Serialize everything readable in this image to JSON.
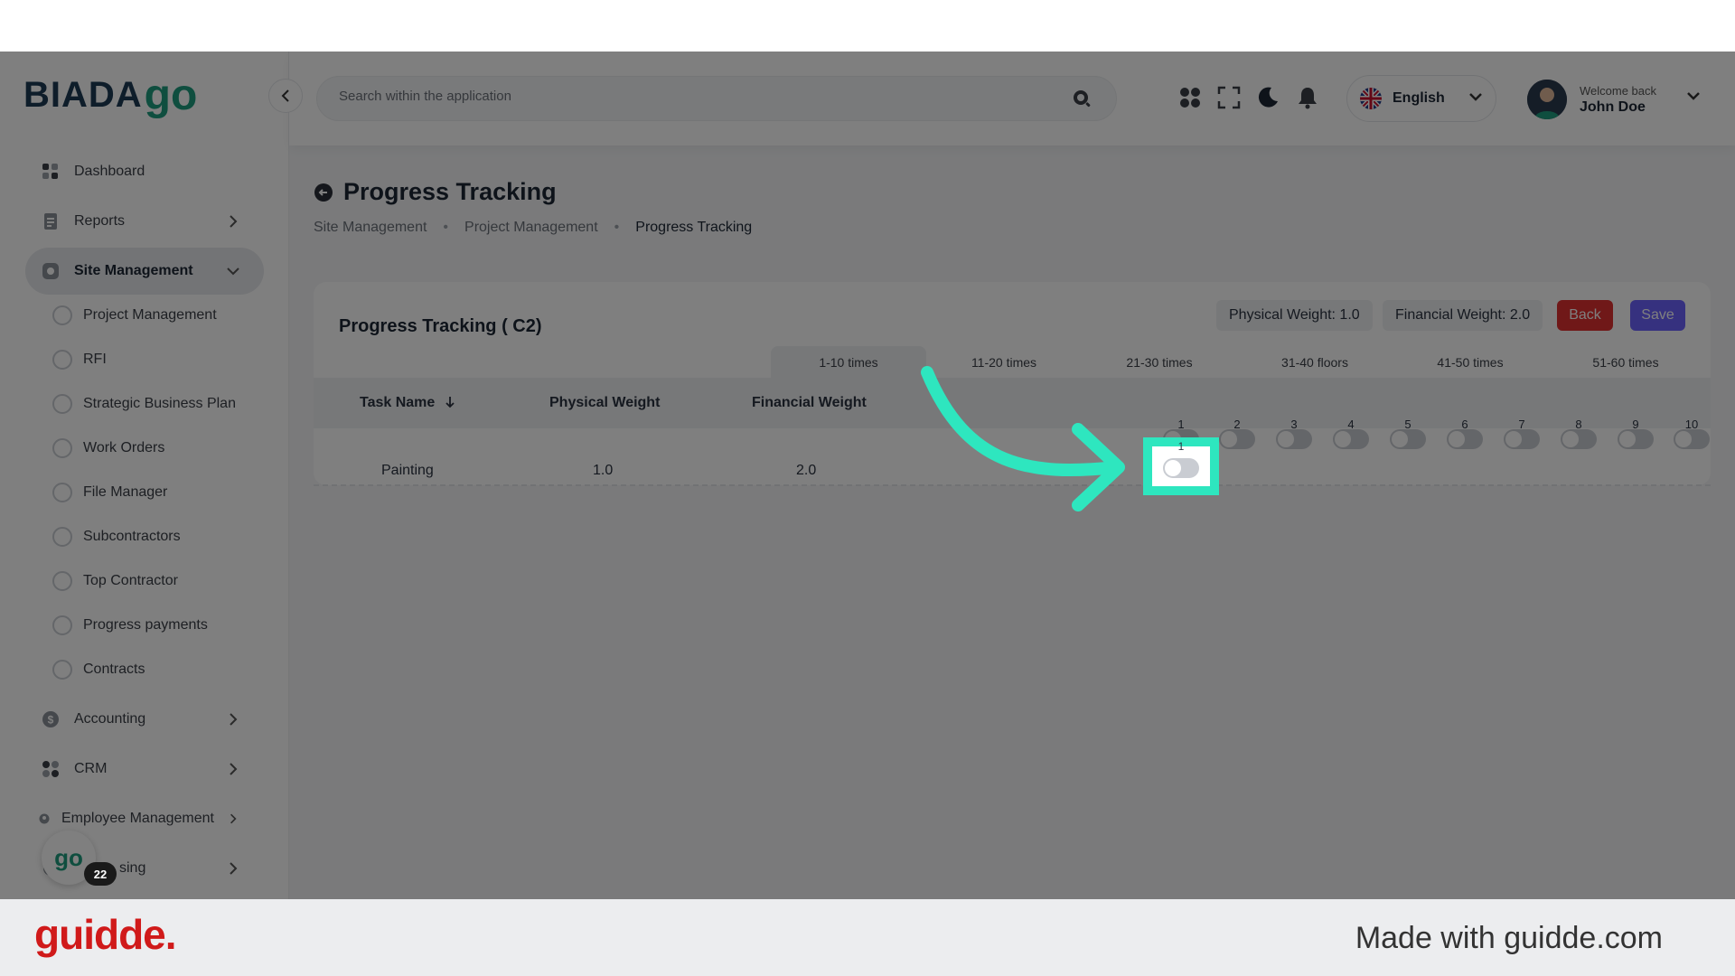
{
  "app": {
    "logo_text": "BIADA",
    "logo_go": "go"
  },
  "sidebar": {
    "items": [
      {
        "label": "Dashboard",
        "icon": "dashboard-icon"
      },
      {
        "label": "Reports",
        "icon": "reports-icon"
      },
      {
        "label": "Site Management",
        "icon": "site-icon"
      },
      {
        "label": "Accounting",
        "icon": "dollar-icon"
      },
      {
        "label": "CRM",
        "icon": "crm-icon"
      },
      {
        "label": "Employee Management",
        "icon": "employee-icon"
      },
      {
        "label": "sing",
        "icon": "leasing-icon"
      }
    ],
    "sub_items": [
      "Project Management",
      "RFI",
      "Strategic Business Plan",
      "Work Orders",
      "File Manager",
      "Subcontractors",
      "Top Contractor",
      "Progress payments",
      "Contracts"
    ]
  },
  "topbar": {
    "search_placeholder": "Search within the application",
    "language": "English",
    "welcome": "Welcome back",
    "user_name": "John Doe"
  },
  "page": {
    "title": "Progress Tracking",
    "breadcrumb": [
      "Site Management",
      "Project Management",
      "Progress Tracking"
    ]
  },
  "card": {
    "title": "Progress Tracking ( C2)",
    "physical_chip": "Physical Weight: 1.0",
    "financial_chip": "Financial Weight: 2.0",
    "back_label": "Back",
    "save_label": "Save",
    "range_tabs": [
      "1-10 times",
      "11-20 times",
      "21-30 times",
      "31-40 floors",
      "41-50 times",
      "51-60 times"
    ],
    "columns": [
      "Task Name",
      "Physical Weight",
      "Financial Weight"
    ],
    "row": {
      "task": "Painting",
      "physical": "1.0",
      "financial": "2.0"
    },
    "toggles": [
      "1",
      "2",
      "3",
      "4",
      "5",
      "6",
      "7",
      "8",
      "9",
      "10"
    ]
  },
  "chat": {
    "badge": "22",
    "logo": "go"
  },
  "footer": {
    "brand": "guidde.",
    "made_with": "Made with guidde.com"
  },
  "colors": {
    "accent_teal": "#2ee6bf",
    "back_red": "#e03131",
    "save_purple": "#6c63ff",
    "brand_green": "#1f9d7f"
  }
}
